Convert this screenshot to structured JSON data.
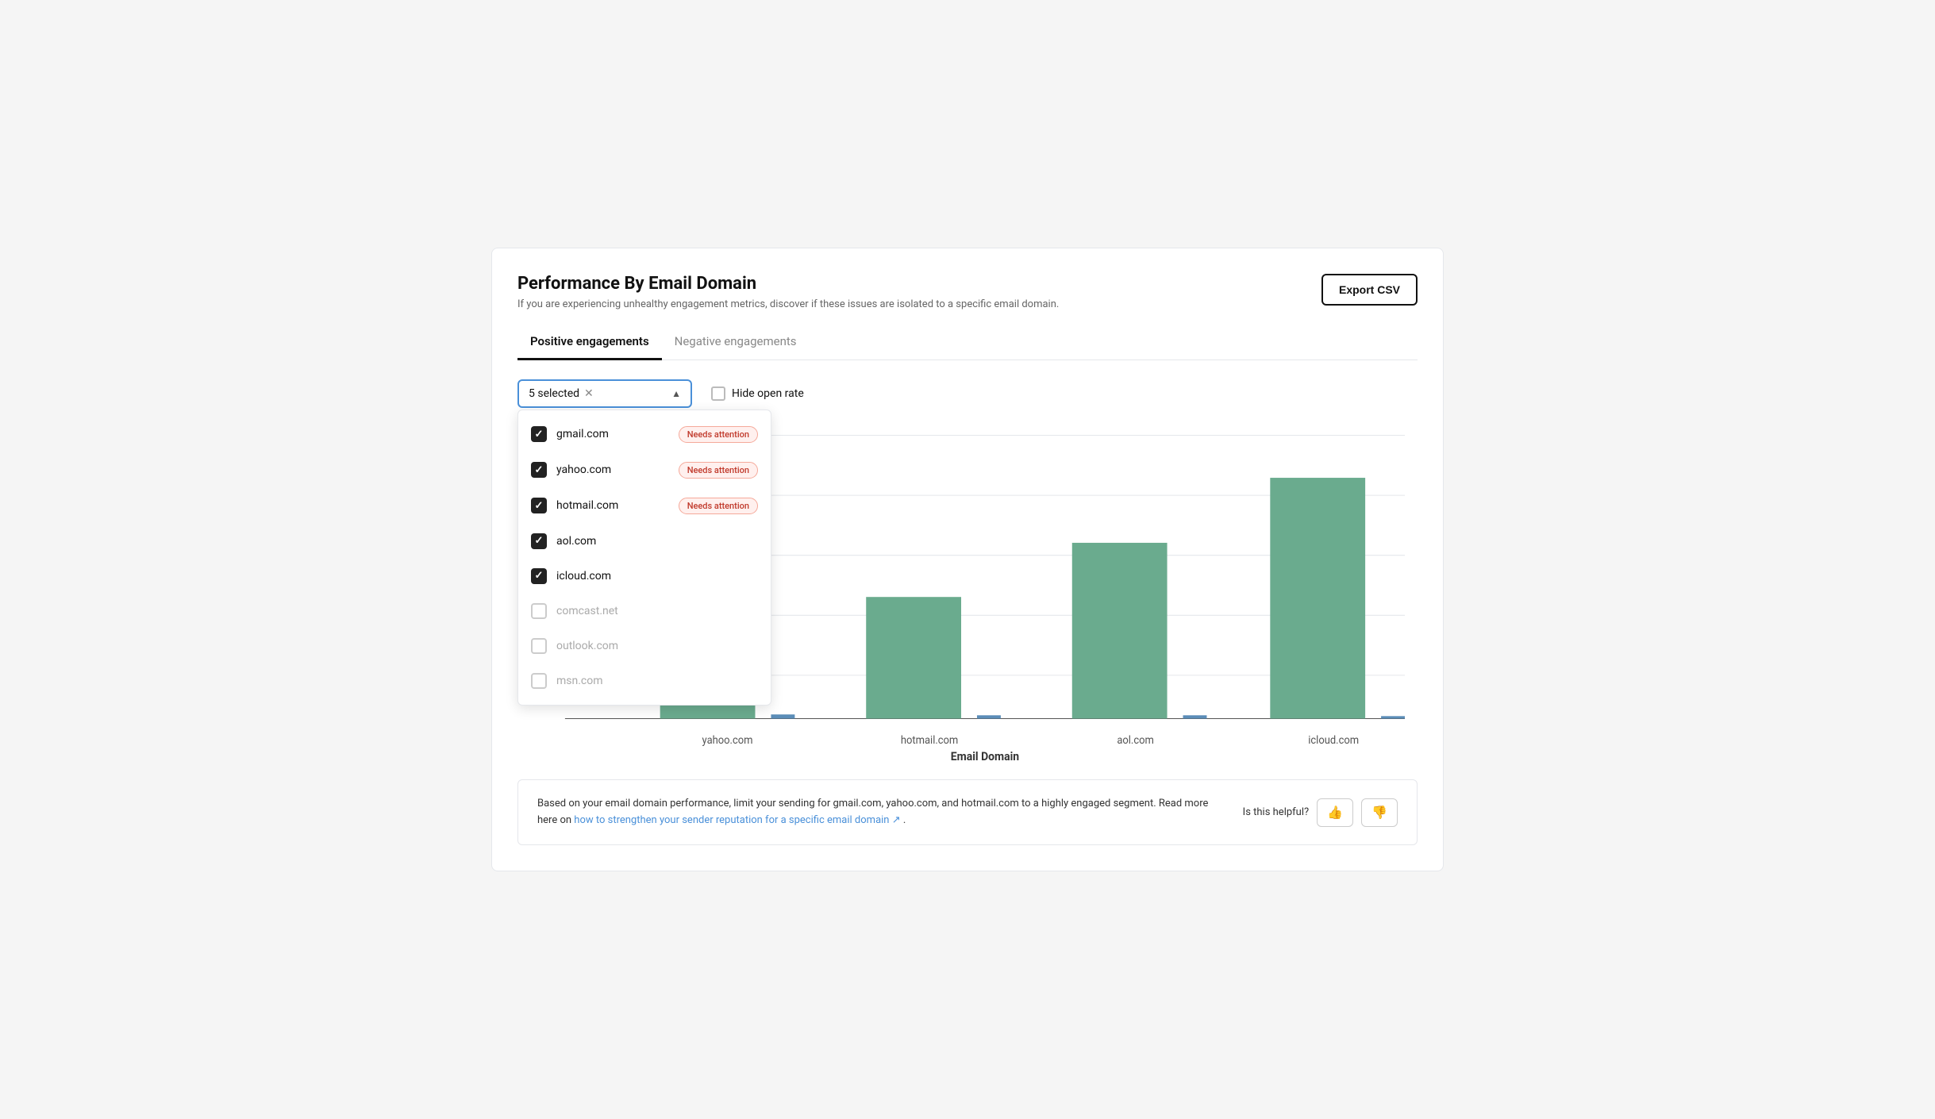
{
  "page": {
    "title": "Performance By Email Domain",
    "subtitle": "If you are experiencing unhealthy engagement metrics, discover if these issues are isolated to a specific email domain.",
    "export_btn": "Export CSV"
  },
  "tabs": [
    {
      "id": "positive",
      "label": "Positive engagements",
      "active": true
    },
    {
      "id": "negative",
      "label": "Negative engagements",
      "active": false
    }
  ],
  "dropdown": {
    "selected_label": "5 selected",
    "items": [
      {
        "id": "gmail",
        "name": "gmail.com",
        "checked": true,
        "badge": "Needs attention"
      },
      {
        "id": "yahoo",
        "name": "yahoo.com",
        "checked": true,
        "badge": "Needs attention"
      },
      {
        "id": "hotmail",
        "name": "hotmail.com",
        "checked": true,
        "badge": "Needs attention"
      },
      {
        "id": "aol",
        "name": "aol.com",
        "checked": true,
        "badge": null
      },
      {
        "id": "icloud",
        "name": "icloud.com",
        "checked": true,
        "badge": null
      },
      {
        "id": "comcast",
        "name": "comcast.net",
        "checked": false,
        "badge": null
      },
      {
        "id": "outlook",
        "name": "outlook.com",
        "checked": false,
        "badge": null
      },
      {
        "id": "msn",
        "name": "msn.com",
        "checked": false,
        "badge": null
      }
    ]
  },
  "hide_open_rate": {
    "label": "Hide open rate",
    "checked": false
  },
  "chart": {
    "x_label": "Email Domain",
    "bars": [
      {
        "domain": "yahoo.com",
        "green_height": 0.55,
        "blue_height": 0.015
      },
      {
        "domain": "hotmail.com",
        "green_height": 0.43,
        "blue_height": 0.012
      },
      {
        "domain": "aol.com",
        "green_height": 0.62,
        "blue_height": 0.012
      },
      {
        "domain": "icloud.com",
        "green_height": 0.85,
        "blue_height": 0.01
      }
    ],
    "bar_color": "#6aab8e",
    "bar2_color": "#5b8db8",
    "grid_lines": [
      0,
      0.2,
      0.4,
      0.6,
      0.8,
      1.0
    ]
  },
  "info_box": {
    "text_before_link": "Based on your email domain performance, limit your sending for gmail.com, yahoo.com, and hotmail.com to a highly engaged segment. Read more here on ",
    "link_text": "how to strengthen your sender reputation for a specific email domain",
    "text_after_link": ".",
    "helpful_label": "Is this helpful?",
    "thumbs_up": "👍",
    "thumbs_down": "👎"
  }
}
